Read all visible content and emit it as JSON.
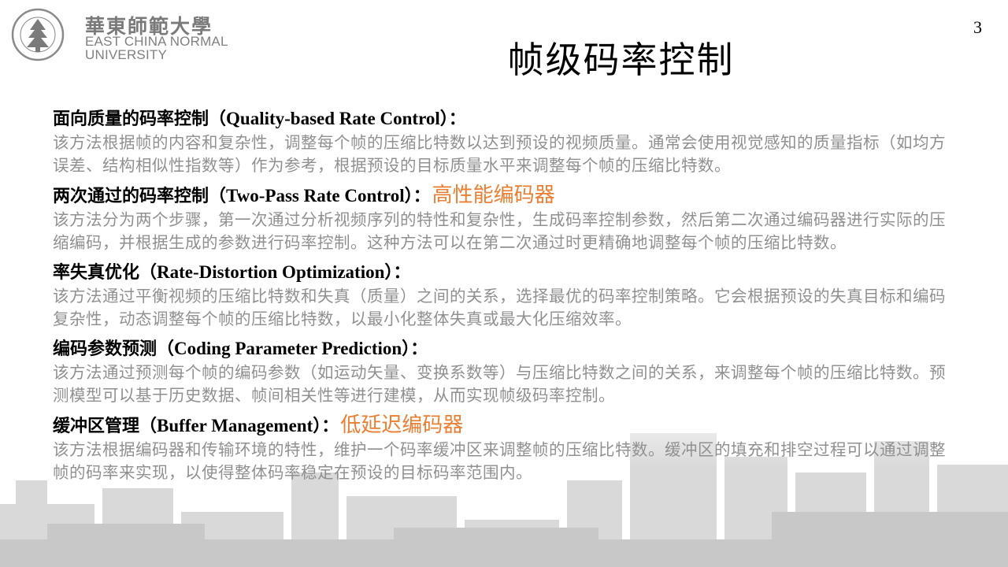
{
  "header": {
    "logo_cn": "華東師範大學",
    "logo_en_line1": "EAST CHINA NORMAL",
    "logo_en_line2": "UNIVERSITY",
    "page_number": "3"
  },
  "title": "帧级码率控制",
  "sections": [
    {
      "heading_cn": "面向质量的码率控制（",
      "heading_en": "Quality-based Rate Control",
      "heading_tail": "）：",
      "note": "",
      "body": "该方法根据帧的内容和复杂性，调整每个帧的压缩比特数以达到预设的视频质量。通常会使用视觉感知的质量指标（如均方误差、结构相似性指数等）作为参考，根据预设的目标质量水平来调整每个帧的压缩比特数。"
    },
    {
      "heading_cn": "两次通过的码率控制（",
      "heading_en": "Two-Pass Rate Control",
      "heading_tail": "）：",
      "note": "高性能编码器",
      "body": "该方法分为两个步骤，第一次通过分析视频序列的特性和复杂性，生成码率控制参数，然后第二次通过编码器进行实际的压缩编码，并根据生成的参数进行码率控制。这种方法可以在第二次通过时更精确地调整每个帧的压缩比特数。"
    },
    {
      "heading_cn": "率失真优化（",
      "heading_en": "Rate-Distortion Optimization",
      "heading_tail": "）：",
      "note": "",
      "body": "该方法通过平衡视频的压缩比特数和失真（质量）之间的关系，选择最优的码率控制策略。它会根据预设的失真目标和编码复杂性，动态调整每个帧的压缩比特数，以最小化整体失真或最大化压缩效率。"
    },
    {
      "heading_cn": "编码参数预测（",
      "heading_en": "Coding Parameter Prediction",
      "heading_tail": "）：",
      "note": "",
      "body": "该方法通过预测每个帧的编码参数（如运动矢量、变换系数等）与压缩比特数之间的关系，来调整每个帧的压缩比特数。预测模型可以基于历史数据、帧间相关性等进行建模，从而实现帧级码率控制。"
    },
    {
      "heading_cn": "缓冲区管理（",
      "heading_en": "Buffer Management",
      "heading_tail": "）：",
      "note": "低延迟编码器",
      "body": "该方法根据编码器和传输环境的特性，维护一个码率缓冲区来调整帧的压缩比特数。缓冲区的填充和排空过程可以通过调整帧的码率来实现，以使得整体码率稳定在预设的目标码率范围内。"
    }
  ],
  "colors": {
    "note": "#ed7d31",
    "body_text": "#909090"
  }
}
